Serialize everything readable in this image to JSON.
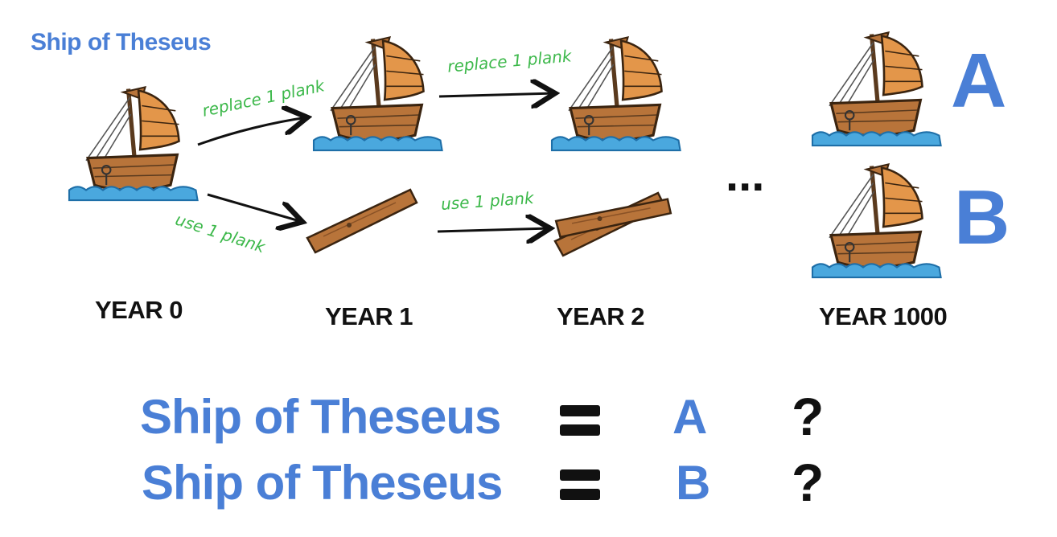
{
  "title": "Ship of Theseus",
  "years": {
    "y0": "YEAR 0",
    "y1": "YEAR 1",
    "y2": "YEAR 2",
    "y1000": "YEAR 1000"
  },
  "annotations": {
    "replace_1": "replace 1 plank",
    "replace_2": "replace 1 plank",
    "use_1": "use 1 plank",
    "use_2": "use 1 plank"
  },
  "ellipsis": "...",
  "labels": {
    "a": "A",
    "b": "B"
  },
  "equations": [
    {
      "subject": "Ship of Theseus",
      "result": "A",
      "question": "?"
    },
    {
      "subject": "Ship of Theseus",
      "result": "B",
      "question": "?"
    }
  ],
  "colors": {
    "accent_blue": "#4a7fd6",
    "hand_green": "#3cb84a",
    "wood": "#b8743a",
    "sail": "#e3964a",
    "water": "#4aa8de"
  }
}
